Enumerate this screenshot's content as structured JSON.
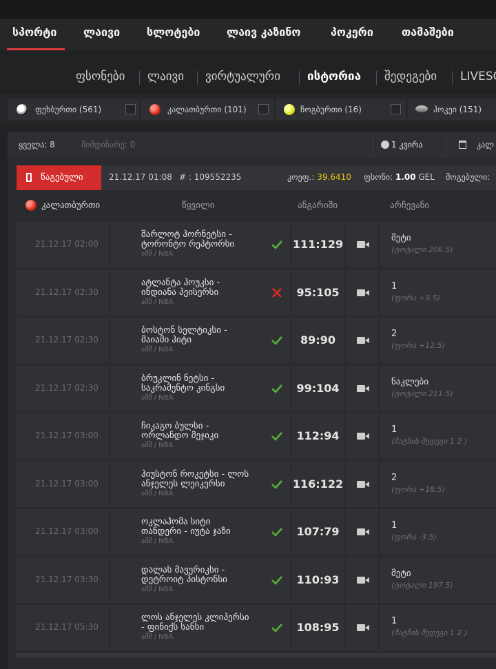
{
  "main_nav": [
    {
      "label": "სპორტი",
      "active": true
    },
    {
      "label": "ლაივი"
    },
    {
      "label": "სლოტები"
    },
    {
      "label": "ლაივ კაზინო"
    },
    {
      "label": "პოკერი"
    },
    {
      "label": "თამაშები"
    }
  ],
  "sub_nav": [
    {
      "label": "ფსონები"
    },
    {
      "label": "ლაივი"
    },
    {
      "label": "ვირტუალური"
    },
    {
      "label": "ისტორია",
      "active": true
    },
    {
      "label": "შედეგები"
    },
    {
      "label": "LIVESC"
    }
  ],
  "sports": [
    {
      "label": "ფეხბურთი (561)",
      "icon": "soccer-ball-icon"
    },
    {
      "label": "კალათბურთი (101)",
      "icon": "basketball-icon"
    },
    {
      "label": "ჩოგბურთი (16)",
      "icon": "tennis-ball-icon"
    },
    {
      "label": "ჰოკეი (151)",
      "icon": "hockey-puck-icon"
    }
  ],
  "filter": {
    "all": "ყველა: 8",
    "ongoing": "მიმდინარე: 0",
    "period": "1 კვირა",
    "calendar": "კალ"
  },
  "bet": {
    "status": "წაგებული",
    "datetime": "21.12.17 01:08",
    "id": "# : 109552235",
    "coef_label": "კოეფ.: ",
    "coef_value": "39.6410",
    "stake_label": "ფსონი: ",
    "stake_value": "1.00",
    "stake_currency": " GEL",
    "win_label": "მოგებული:"
  },
  "table_header": {
    "sport": "კალათბურთი",
    "pair": "წყვილი",
    "score": "ანგარიში",
    "choice": "არჩევანი"
  },
  "rows": [
    {
      "date": "21.12.17 02:00",
      "teams": "შარლოტ ჰორნეტსი - ტორონტო რეპტორსი",
      "league": "აშშ / NBA",
      "result": "won",
      "score": "111:129",
      "pick": "მეტი",
      "pick_detail": "(ტოტალი 206.5)"
    },
    {
      "date": "21.12.17 02:30",
      "teams": "ატლანტა ჰოუკსი - ინდიანა პეისერსი",
      "league": "აშშ / NBA",
      "result": "lost",
      "score": "95:105",
      "pick": "1",
      "pick_detail": "(ფორა +9.5)"
    },
    {
      "date": "21.12.17 02:30",
      "teams": "ბოსტონ სელტიკსი - მაიამი ჰიტი",
      "league": "აშშ / NBA",
      "result": "won",
      "score": "89:90",
      "pick": "2",
      "pick_detail": "(ფორა +12.5)"
    },
    {
      "date": "21.12.17 02:30",
      "teams": "ბრუკლინ ნეტსი - საკრამენტო კინგსი",
      "league": "აშშ / NBA",
      "result": "won",
      "score": "99:104",
      "pick": "ნაკლები",
      "pick_detail": "(ტოტალი 211.5)"
    },
    {
      "date": "21.12.17 03:00",
      "teams": "ჩიკაგო ბულსი - ორლანდო მეჯიკი",
      "league": "აშშ / NBA",
      "result": "won",
      "score": "112:94",
      "pick": "1",
      "pick_detail": "(მატჩის შედეგი 1 2 )"
    },
    {
      "date": "21.12.17 03:00",
      "teams": "ჰიუსტონ როკეტსი - ლოს ანჯელეს ლეიკერსი",
      "league": "აშშ / NBA",
      "result": "won",
      "score": "116:122",
      "pick": "2",
      "pick_detail": "(ფორა +18.5)"
    },
    {
      "date": "21.12.17 03:00",
      "teams": "ოკლაჰომა სიტი თანდერი - იუტა ჯაზი",
      "league": "აშშ / NBA",
      "result": "won",
      "score": "107:79",
      "pick": "1",
      "pick_detail": "(ფორა -3.5)"
    },
    {
      "date": "21.12.17 03:30",
      "teams": "დალას მავერიკსი - დეტროიტ პისტონსი",
      "league": "აშშ / NBA",
      "result": "won",
      "score": "110:93",
      "pick": "მეტი",
      "pick_detail": "(ტოტალი 197.5)"
    },
    {
      "date": "21.12.17 05:30",
      "teams": "ლოს ანჯელეს კლიპერსი - ფინიქს სანსი",
      "league": "აშშ / NBA",
      "result": "won",
      "score": "108:95",
      "pick": "1",
      "pick_detail": "(მატჩის შედეგი 1 2 )"
    }
  ],
  "colors": {
    "accent_red": "#e23a3a",
    "lost_badge": "#d32c2c",
    "coef_yellow": "#f0c419",
    "won_green": "#56b232",
    "lost_red": "#e02828"
  }
}
